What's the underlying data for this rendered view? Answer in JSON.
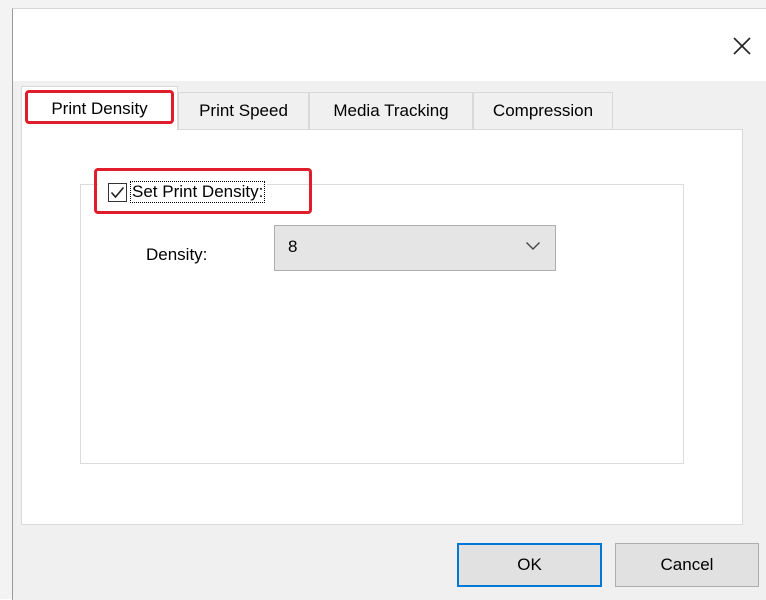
{
  "dialog": {
    "close_icon": "close-icon"
  },
  "tabs": [
    {
      "label": "Print Density",
      "active": true
    },
    {
      "label": "Print Speed",
      "active": false
    },
    {
      "label": "Media Tracking",
      "active": false
    },
    {
      "label": "Compression",
      "active": false
    }
  ],
  "group": {
    "checkbox_label": "Set Print Density:",
    "checked": true
  },
  "density": {
    "label": "Density:",
    "value": "8"
  },
  "buttons": {
    "ok": "OK",
    "cancel": "Cancel"
  },
  "colors": {
    "highlight": "#e01e2b",
    "default_button_border": "#0078d7"
  }
}
